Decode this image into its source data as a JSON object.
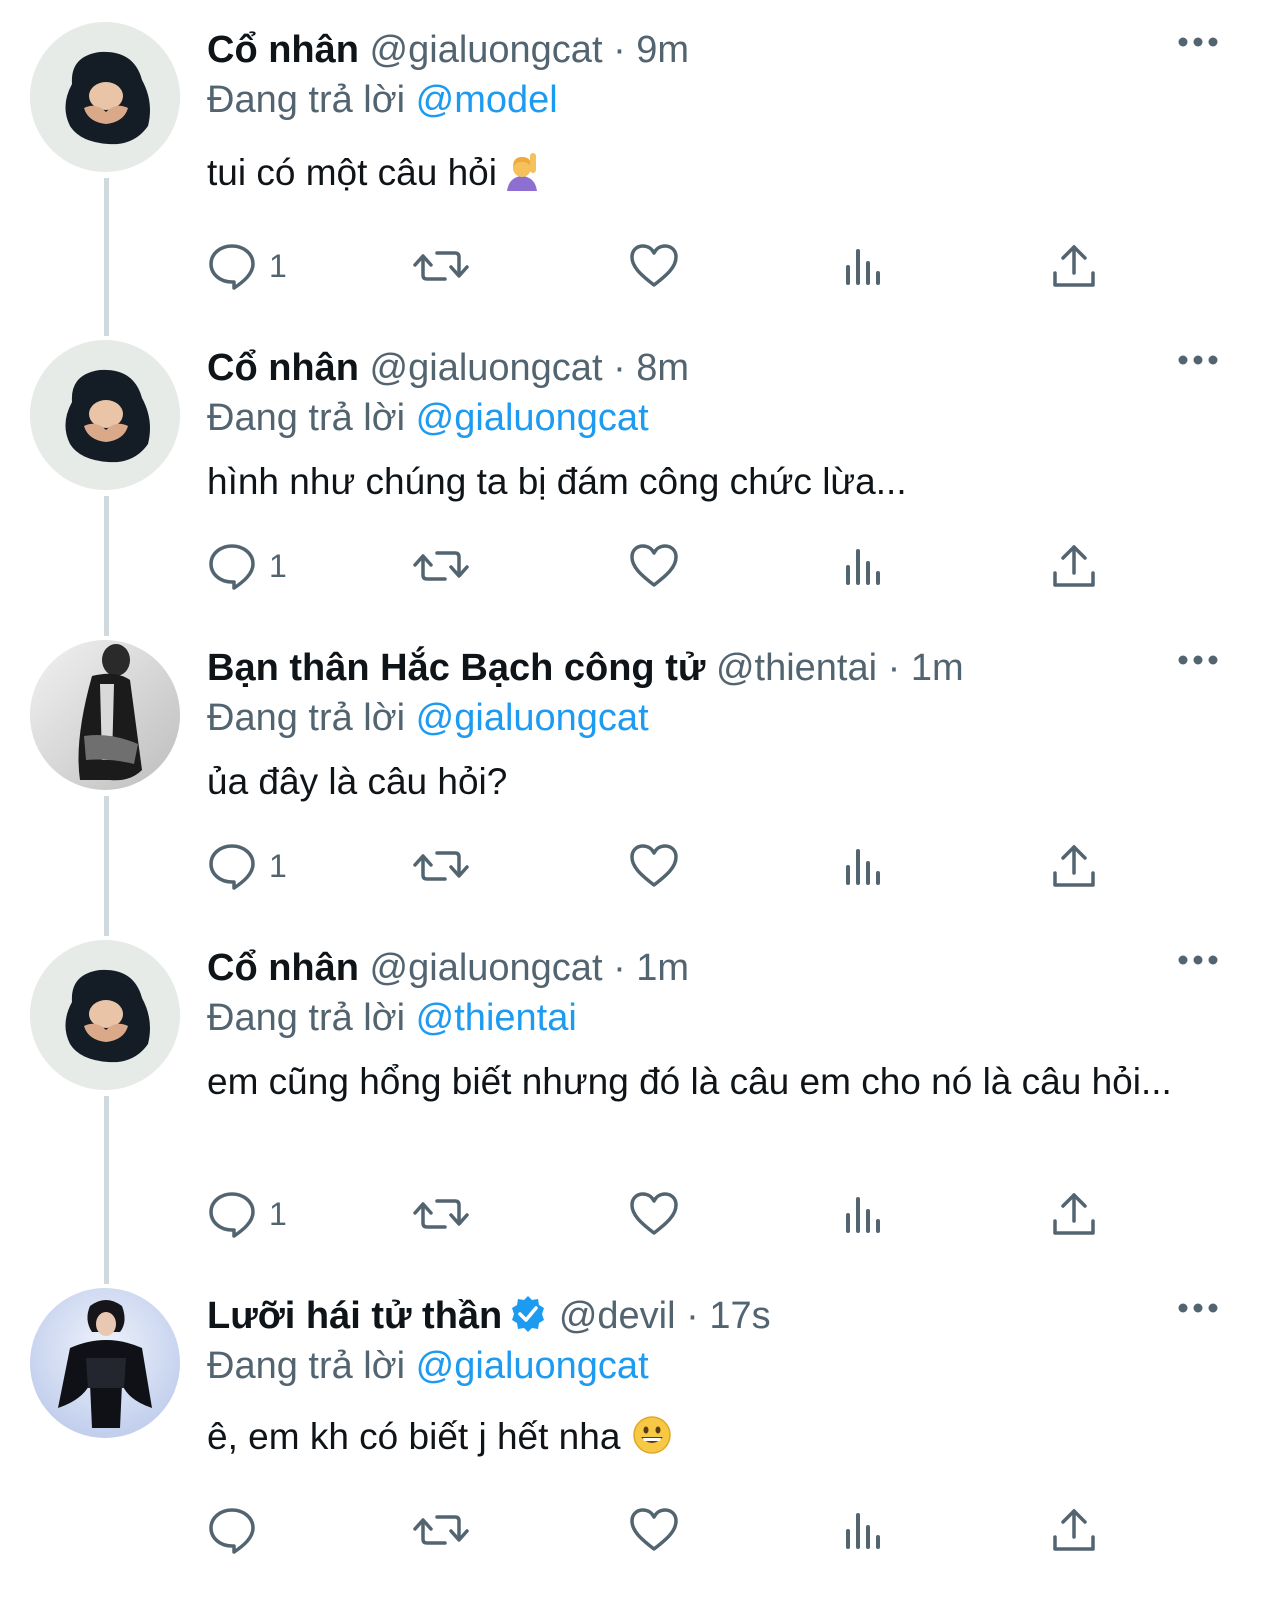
{
  "colors": {
    "accent": "#1d9bf0",
    "muted": "#536471",
    "text": "#0f1419",
    "thread_line": "#cfd9de"
  },
  "tweets": [
    {
      "name": "Cổ nhân",
      "handle": "@gialuongcat",
      "sep": "·",
      "time": "9m",
      "reply_prefix": "Đang trả lời",
      "reply_to": "@model",
      "text": "tui có một câu hỏi",
      "emoji": "person-raising-hand-emoji",
      "reply_count": "1"
    },
    {
      "name": "Cổ nhân",
      "handle": "@gialuongcat",
      "sep": "·",
      "time": "8m",
      "reply_prefix": "Đang trả lời",
      "reply_to": "@gialuongcat",
      "text": "hình như chúng ta bị đám công chức lừa...",
      "reply_count": "1"
    },
    {
      "name": "Bạn thân Hắc Bạch công tử",
      "handle": "@thientai",
      "sep": "·",
      "time": "1m",
      "reply_prefix": "Đang trả lời",
      "reply_to": "@gialuongcat",
      "text": "ủa đây là câu hỏi?",
      "reply_count": "1"
    },
    {
      "name": "Cổ nhân",
      "handle": "@gialuongcat",
      "sep": "·",
      "time": "1m",
      "reply_prefix": "Đang trả lời",
      "reply_to": "@thientai",
      "text": "em cũng hổng biết nhưng đó là câu em cho nó là câu hỏi...",
      "reply_count": "1"
    },
    {
      "name": "Lưỡi hái tử thần",
      "verified": true,
      "handle": "@devil",
      "sep": "·",
      "time": "17s",
      "reply_prefix": "Đang trả lời",
      "reply_to": "@gialuongcat",
      "text": "ê, em kh có biết j hết nha",
      "emoji": "grinning-face-emoji",
      "reply_count": ""
    }
  ]
}
